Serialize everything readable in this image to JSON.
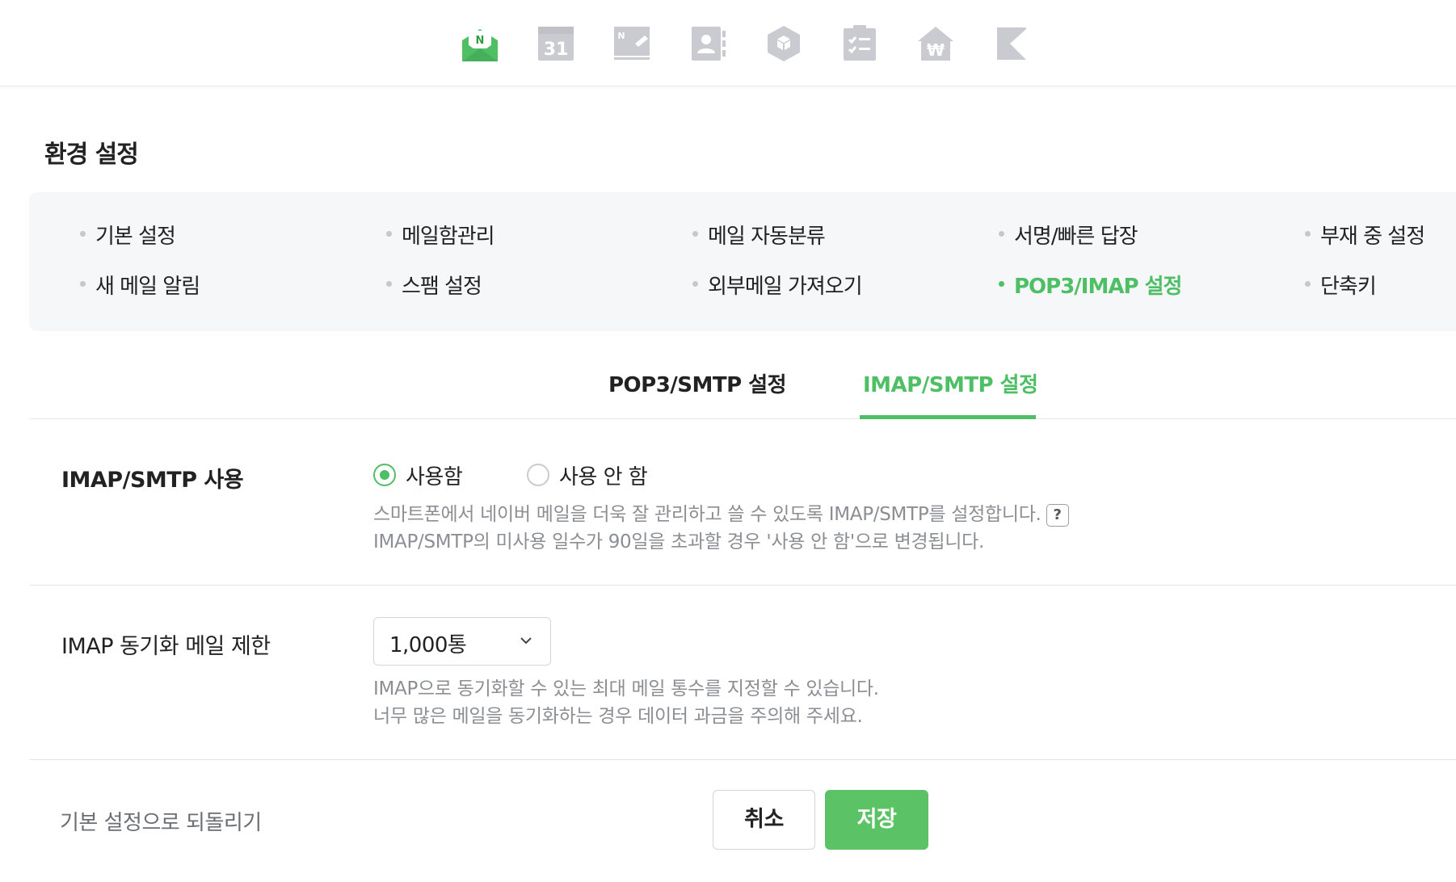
{
  "topbar": {
    "apps": [
      {
        "name": "mail-icon",
        "label": "N",
        "active": true
      },
      {
        "name": "calendar-icon",
        "label": "31",
        "active": false
      },
      {
        "name": "memo-icon",
        "label": "N",
        "active": false
      },
      {
        "name": "contacts-icon",
        "label": "",
        "active": false
      },
      {
        "name": "mybox-icon",
        "label": "",
        "active": false
      },
      {
        "name": "todo-icon",
        "label": "",
        "active": false
      },
      {
        "name": "household-ledger-icon",
        "label": "₩",
        "active": false
      },
      {
        "name": "more-app-icon",
        "label": "",
        "active": false
      }
    ],
    "accent_color": "#4fbf65",
    "inactive_icon_color": "#c9cbd0"
  },
  "page_title": "환경 설정",
  "settings_menu": {
    "items": [
      {
        "label": "기본 설정",
        "active": false
      },
      {
        "label": "메일함관리",
        "active": false
      },
      {
        "label": "메일 자동분류",
        "active": false
      },
      {
        "label": "서명/빠른 답장",
        "active": false
      },
      {
        "label": "부재 중 설정",
        "active": false
      },
      {
        "label": "새 메일 알림",
        "active": false
      },
      {
        "label": "스팸 설정",
        "active": false
      },
      {
        "label": "외부메일 가져오기",
        "active": false
      },
      {
        "label": "POP3/IMAP 설정",
        "active": true
      },
      {
        "label": "단축키",
        "active": false
      }
    ]
  },
  "tabs": [
    {
      "label": "POP3/SMTP 설정",
      "active": false
    },
    {
      "label": "IMAP/SMTP 설정",
      "active": true
    }
  ],
  "imap_usage": {
    "label": "IMAP/SMTP 사용",
    "options": [
      {
        "label": "사용함",
        "checked": true
      },
      {
        "label": "사용 안 함",
        "checked": false
      }
    ],
    "desc_line1": "스마트폰에서 네이버 메일을 더욱 잘 관리하고 쓸 수 있도록 IMAP/SMTP를 설정합니다.",
    "help_label": "?",
    "desc_line2": "IMAP/SMTP의 미사용 일수가 90일을 초과할 경우 '사용 안 함'으로 변경됩니다."
  },
  "imap_sync_limit": {
    "label": "IMAP 동기화 메일 제한",
    "selected_value": "1,000통",
    "desc_line1": "IMAP으로 동기화할 수 있는 최대 메일 통수를 지정할 수 있습니다.",
    "desc_line2": "너무 많은 메일을 동기화하는 경우 데이터 과금을 주의해 주세요."
  },
  "footer": {
    "reset_label": "기본 설정으로 되돌리기",
    "cancel_label": "취소",
    "save_label": "저장"
  }
}
